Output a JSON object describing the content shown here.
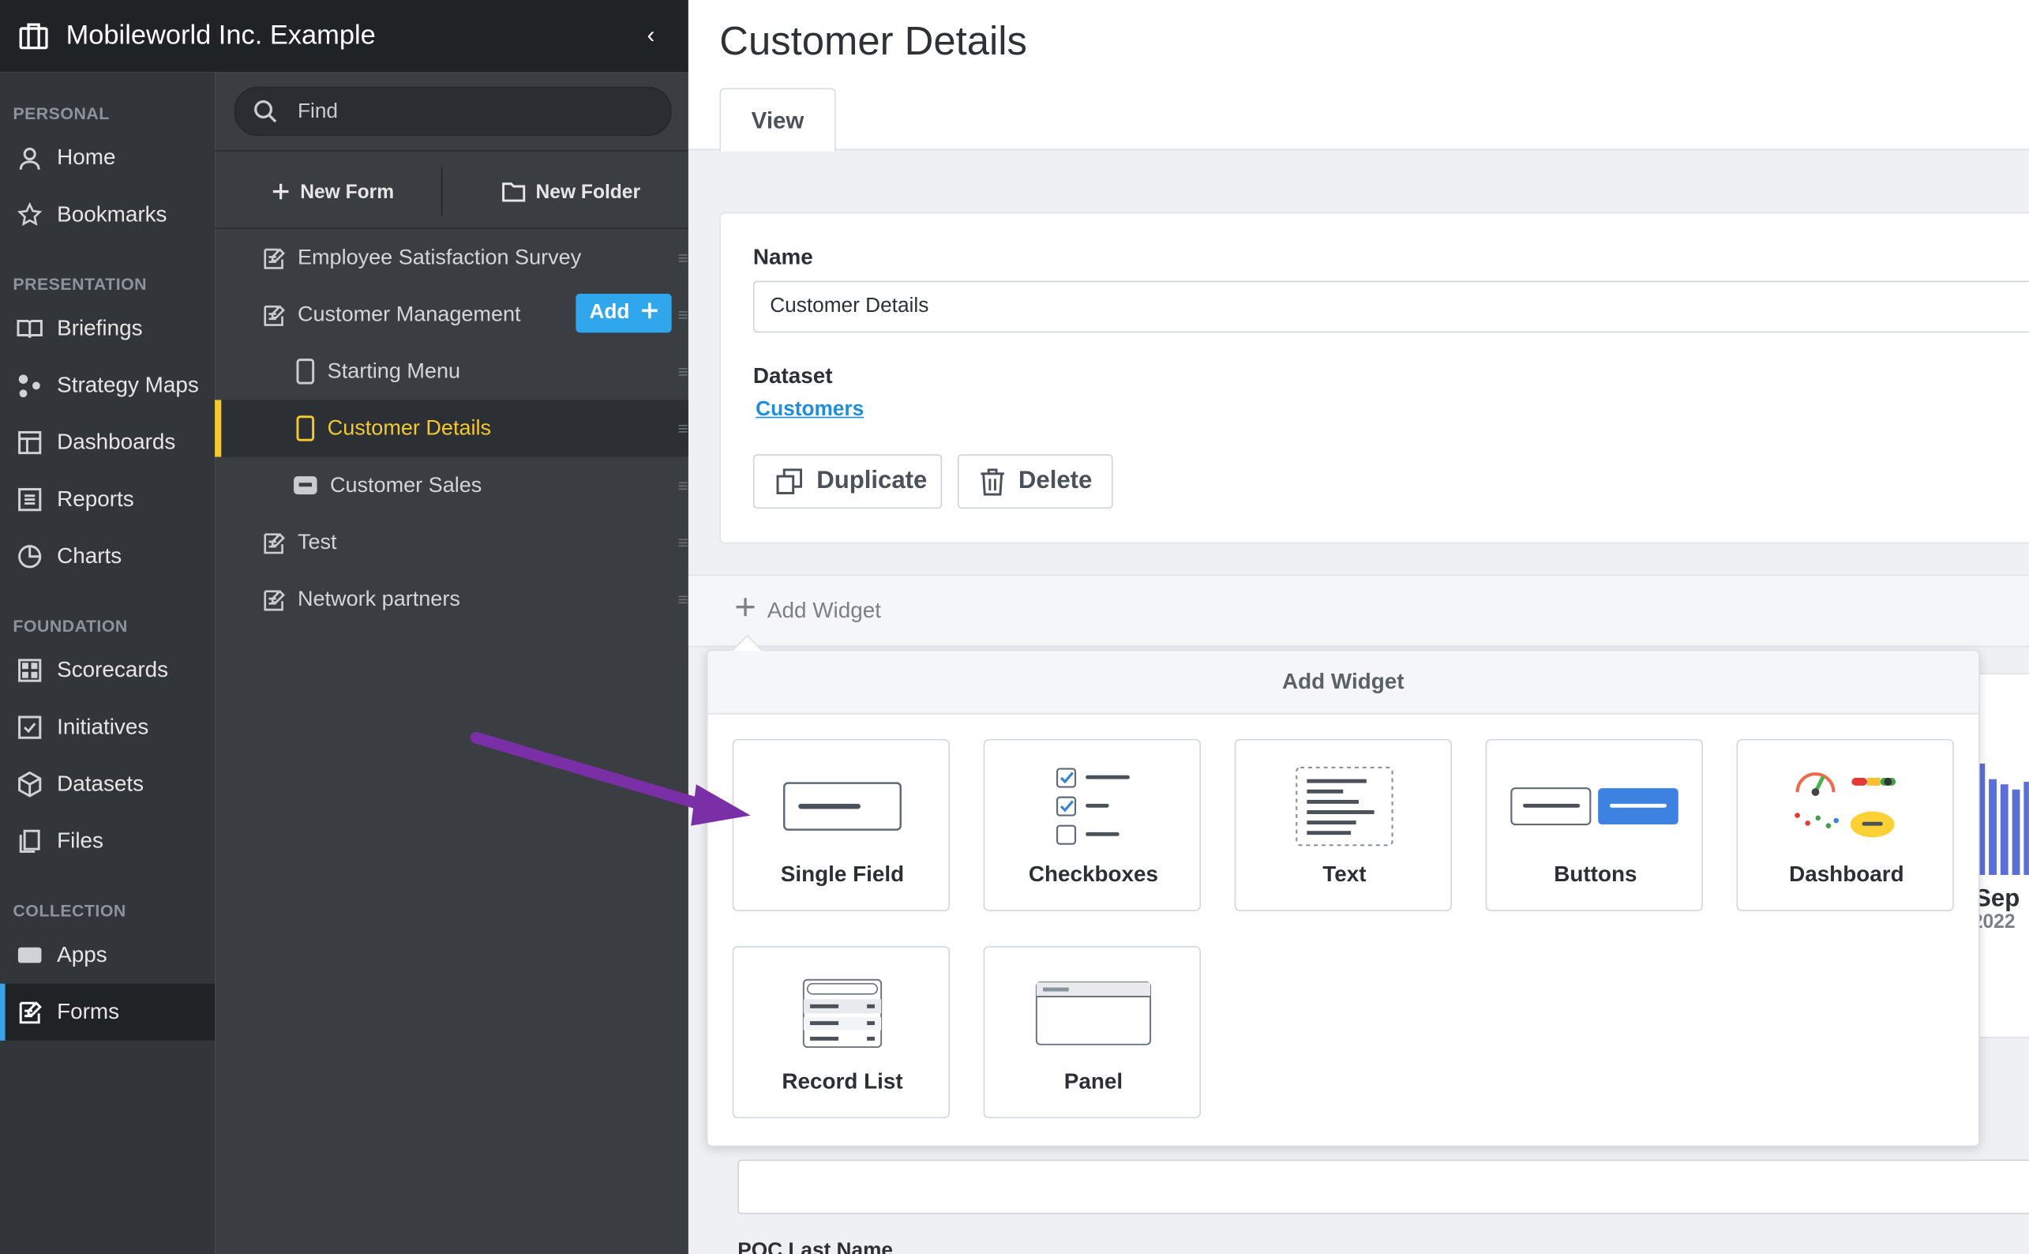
{
  "app": {
    "title": "Mobileworld Inc. Example"
  },
  "nav": {
    "sections": [
      {
        "label": "PERSONAL",
        "items": [
          "Home",
          "Bookmarks"
        ]
      },
      {
        "label": "PRESENTATION",
        "items": [
          "Briefings",
          "Strategy Maps",
          "Dashboards",
          "Reports",
          "Charts"
        ]
      },
      {
        "label": "FOUNDATION",
        "items": [
          "Scorecards",
          "Initiatives",
          "Datasets",
          "Files"
        ]
      },
      {
        "label": "COLLECTION",
        "items": [
          "Apps",
          "Forms"
        ]
      }
    ],
    "active": "Forms"
  },
  "tree": {
    "search_placeholder": "Find",
    "new_form": "New Form",
    "new_folder": "New Folder",
    "add_label": "Add",
    "items": [
      {
        "label": "Employee Satisfaction Survey",
        "level": 0
      },
      {
        "label": "Customer Management",
        "level": 0
      },
      {
        "label": "Starting Menu",
        "level": 1
      },
      {
        "label": "Customer Details",
        "level": 1,
        "selected": true
      },
      {
        "label": "Customer Sales",
        "level": 1
      },
      {
        "label": "Test",
        "level": 0
      },
      {
        "label": "Network partners",
        "level": 0
      }
    ]
  },
  "main": {
    "title": "Customer Details",
    "tab": "View",
    "name_label": "Name",
    "name_value": "Customer Details",
    "dataset_label": "Dataset",
    "dataset_link": "Customers",
    "duplicate": "Duplicate",
    "delete": "Delete",
    "add_widget": "Add Widget",
    "bg_month": "Sep",
    "bg_year": "2022",
    "bottom_label": "POC Last Name"
  },
  "popover": {
    "title": "Add Widget",
    "widgets": [
      "Single Field",
      "Checkboxes",
      "Text",
      "Buttons",
      "Dashboard",
      "Record List",
      "Panel"
    ]
  },
  "colors": {
    "accent": "#30a7ec",
    "selected": "#f3c92f",
    "arrow": "#7a2fa6",
    "bar": "#5b6fd6"
  }
}
